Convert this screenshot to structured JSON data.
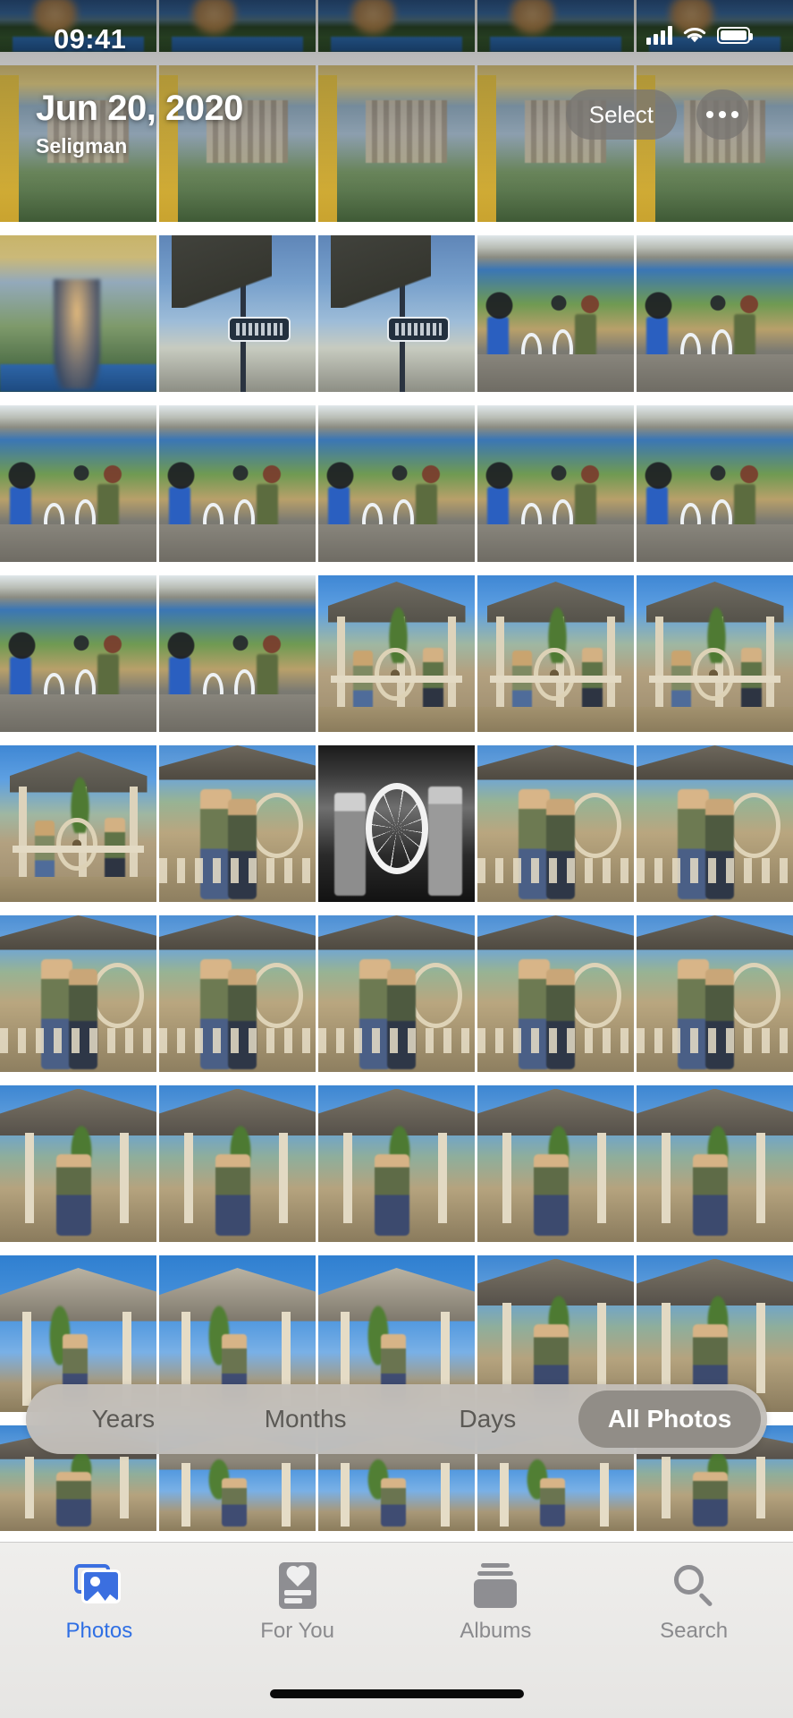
{
  "status_bar": {
    "time": "09:41",
    "cellular_icon": "signal-bars-icon",
    "wifi_icon": "wifi-icon",
    "battery_icon": "battery-icon"
  },
  "header": {
    "date": "Jun 20, 2020",
    "location": "Seligman",
    "select_label": "Select",
    "more_icon": "ellipsis-icon"
  },
  "segmented_control": {
    "options": [
      {
        "label": "Years",
        "active": false
      },
      {
        "label": "Months",
        "active": false
      },
      {
        "label": "Days",
        "active": false
      },
      {
        "label": "All Photos",
        "active": true
      }
    ]
  },
  "tab_bar": {
    "tabs": [
      {
        "label": "Photos",
        "icon": "photos-icon",
        "active": true
      },
      {
        "label": "For You",
        "icon": "for-you-icon",
        "active": false
      },
      {
        "label": "Albums",
        "icon": "albums-icon",
        "active": false
      },
      {
        "label": "Search",
        "icon": "search-icon",
        "active": false
      }
    ]
  },
  "colors": {
    "accent": "#2f6fe4",
    "tab_inactive": "#8a8a8d",
    "tab_bar_bg": "#eae9e7",
    "pill_bg": "#c4c0ba",
    "pill_active": "#918d87",
    "overlay_button": "#787672"
  },
  "photo_grid": {
    "columns": 5,
    "rows": [
      {
        "type": "crop-top",
        "scenes": [
          "sA",
          "sA",
          "sA",
          "sA",
          "sA"
        ]
      },
      {
        "type": "full",
        "scenes": [
          "sB",
          "sB",
          "sB",
          "sB",
          "sB"
        ]
      },
      {
        "type": "full",
        "scenes": [
          "sC",
          "sD",
          "sD",
          "sE",
          "sE"
        ]
      },
      {
        "type": "full",
        "scenes": [
          "sE",
          "sE",
          "sE",
          "sE",
          "sE"
        ]
      },
      {
        "type": "full",
        "scenes": [
          "sE",
          "sE",
          "sF",
          "sF",
          "sF"
        ]
      },
      {
        "type": "full",
        "scenes": [
          "sF",
          "sI",
          "sH",
          "sI",
          "sI"
        ]
      },
      {
        "type": "full",
        "scenes": [
          "sI",
          "sI",
          "sI",
          "sI",
          "sI"
        ]
      },
      {
        "type": "full",
        "scenes": [
          "sJ",
          "sJ",
          "sJ",
          "sJ",
          "sJ"
        ]
      },
      {
        "type": "full",
        "scenes": [
          "sG",
          "sG",
          "sG",
          "sJ",
          "sJ"
        ]
      },
      {
        "type": "crop-bottom",
        "scenes": [
          "sJ",
          "sG",
          "sG",
          "sG",
          "sJ"
        ]
      }
    ]
  }
}
